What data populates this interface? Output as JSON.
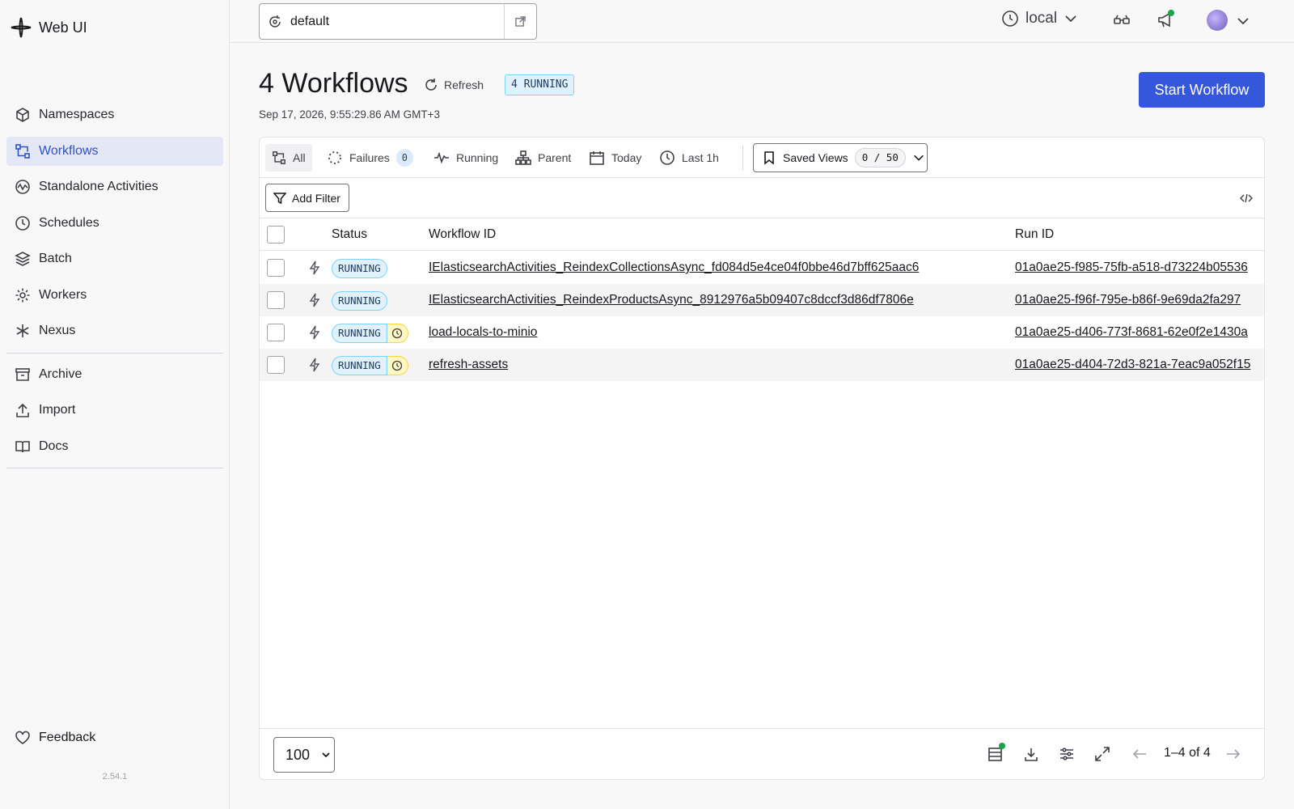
{
  "app": {
    "name": "Web UI",
    "version": "2.54.1"
  },
  "sidebar": {
    "items": [
      {
        "label": "Namespaces",
        "icon": "namespaces-icon"
      },
      {
        "label": "Workflows",
        "icon": "workflows-icon",
        "active": true
      },
      {
        "label": "Standalone Activities",
        "icon": "activities-icon"
      },
      {
        "label": "Schedules",
        "icon": "clock-icon"
      },
      {
        "label": "Batch",
        "icon": "layers-icon"
      },
      {
        "label": "Workers",
        "icon": "gear-icon"
      },
      {
        "label": "Nexus",
        "icon": "asterisk-icon"
      }
    ],
    "secondary": [
      {
        "label": "Archive",
        "icon": "archive-icon"
      },
      {
        "label": "Import",
        "icon": "upload-icon"
      },
      {
        "label": "Docs",
        "icon": "book-icon"
      }
    ],
    "feedback_label": "Feedback"
  },
  "topbar": {
    "namespace": "default",
    "timezone": "local"
  },
  "header": {
    "title": "4 Workflows",
    "refresh_label": "Refresh",
    "running_badge": "4 RUNNING",
    "timestamp": "Sep 17, 2026, 9:55:29.86 AM GMT+3",
    "start_button": "Start Workflow"
  },
  "filters": {
    "all": "All",
    "failures": "Failures",
    "failures_count": "0",
    "running": "Running",
    "parent": "Parent",
    "today": "Today",
    "last1h": "Last 1h",
    "saved_views": "Saved Views",
    "saved_count": "0 / 50",
    "add_filter": "Add Filter"
  },
  "table": {
    "columns": {
      "status": "Status",
      "workflow_id": "Workflow ID",
      "run_id": "Run ID"
    },
    "rows": [
      {
        "status": "RUNNING",
        "scheduled": false,
        "workflow_id": "IElasticsearchActivities_ReindexCollectionsAsync_fd084d5e4ce04f0bbe46d7bff625aac6",
        "run_id": "01a0ae25-f985-75fb-a518-d73224b05536"
      },
      {
        "status": "RUNNING",
        "scheduled": false,
        "workflow_id": "IElasticsearchActivities_ReindexProductsAsync_8912976a5b09407c8dccf3d86df7806e",
        "run_id": "01a0ae25-f96f-795e-b86f-9e69da2fa297"
      },
      {
        "status": "RUNNING",
        "scheduled": true,
        "workflow_id": "load-locals-to-minio",
        "run_id": "01a0ae25-d406-773f-8681-62e0f2e1430a"
      },
      {
        "status": "RUNNING",
        "scheduled": true,
        "workflow_id": "refresh-assets",
        "run_id": "01a0ae25-d404-72d3-821a-7eac9a052f15"
      }
    ]
  },
  "footer": {
    "page_size": "100",
    "page_count": "1–4 of 4"
  },
  "colors": {
    "accent": "#3557db",
    "running_bg": "#e0f2fe",
    "running_border": "#7dd3fc"
  }
}
